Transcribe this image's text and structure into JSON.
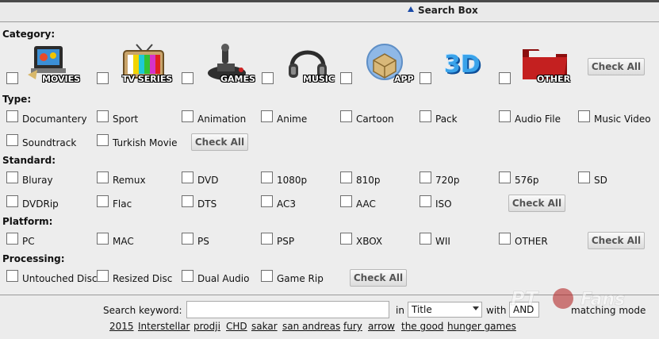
{
  "header": {
    "title": "Search Box"
  },
  "category": {
    "label": "Category:",
    "items": [
      "MOVIES",
      "TV SERIES",
      "GAMES",
      "MUSIC",
      "APP",
      "3D",
      "OTHER"
    ],
    "check_all": "Check All"
  },
  "type": {
    "label": "Type:",
    "items": [
      "Documantery",
      "Sport",
      "Animation",
      "Anime",
      "Cartoon",
      "Pack",
      "Audio File",
      "Music Video",
      "Soundtrack",
      "Turkish Movie"
    ],
    "check_all": "Check All"
  },
  "standard": {
    "label": "Standard:",
    "items": [
      "Bluray",
      "Remux",
      "DVD",
      "1080p",
      "810p",
      "720p",
      "576p",
      "SD",
      "DVDRip",
      "Flac",
      "DTS",
      "AC3",
      "AAC",
      "ISO"
    ],
    "check_all": "Check All"
  },
  "platform": {
    "label": "Platform:",
    "items": [
      "PC",
      "MAC",
      "PS",
      "PSP",
      "XBOX",
      "WII",
      "OTHER"
    ],
    "check_all": "Check All"
  },
  "processing": {
    "label": "Processing:",
    "items": [
      "Untouched Disc",
      "Resized Disc",
      "Dual Audio",
      "Game Rip"
    ],
    "check_all": "Check All"
  },
  "search": {
    "keyword_label": "Search keyword:",
    "keyword_value": "",
    "in_label": "in",
    "in_value": "Title",
    "with_label": "with",
    "with_value": "AND",
    "mode_label": "matching mode",
    "popular": [
      "2015",
      "Interstellar",
      "prodji",
      "CHD",
      "sakar",
      "san andreas",
      "fury",
      "arrow",
      "the good",
      "hunger games"
    ]
  },
  "watermark": {
    "text": "PT Fans"
  },
  "colors": {
    "page_bg": "#ededed",
    "link": "#111111",
    "arrow": "#1a4aa8"
  }
}
